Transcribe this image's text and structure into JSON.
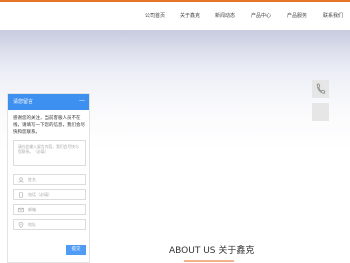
{
  "nav": {
    "items": [
      {
        "label": "公司首页"
      },
      {
        "label": "关于鑫克"
      },
      {
        "label": "新闻动态"
      },
      {
        "label": "产品中心"
      },
      {
        "label": "产品服务"
      },
      {
        "label": "联系我们"
      }
    ]
  },
  "chat": {
    "title": "请您留言",
    "minimize": "—",
    "intro": "感谢您的关注，当前客服人员不在线，请填写一下您的信息，我们会尽快和您联系。",
    "message_placeholder": "请在此输入留言内容，我们会尽快与您联系。（必填）",
    "fields": [
      {
        "placeholder": "姓名",
        "icon": "person-icon"
      },
      {
        "placeholder": "电话（必填）",
        "icon": "phone-icon"
      },
      {
        "placeholder": "邮箱",
        "icon": "email-icon"
      },
      {
        "placeholder": "地址",
        "icon": "location-icon"
      }
    ],
    "submit": "提交"
  },
  "sidebar_tools": [
    {
      "icon": "phone-icon"
    },
    {
      "icon": ""
    }
  ],
  "section": {
    "title": "ABOUT US 关于鑫克"
  },
  "colors": {
    "accent_orange": "#e8742a",
    "chat_blue": "#3d8ff0",
    "submit_blue": "#4f9bf5",
    "side_gray": "#e6e6e6"
  }
}
